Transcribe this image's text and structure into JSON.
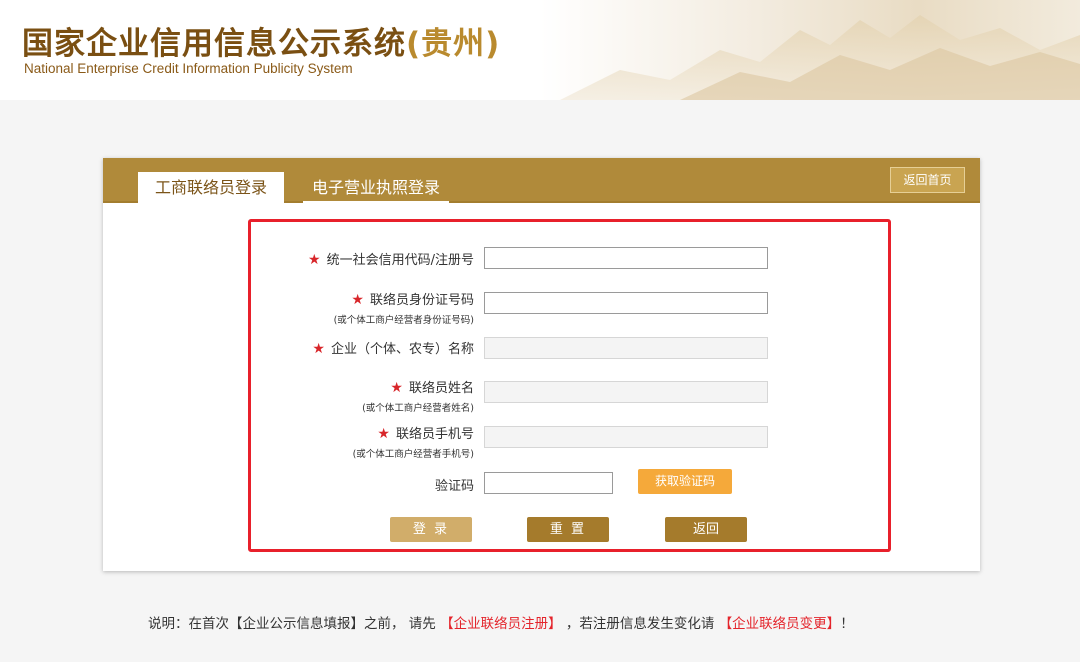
{
  "header": {
    "title": "国家企业信用信息公示系统",
    "title_region": "(贵州)",
    "subtitle": "National Enterprise Credit Information Publicity System"
  },
  "tabs": [
    {
      "label": "工商联络员登录",
      "active": true
    },
    {
      "label": "电子营业执照登录",
      "active": false
    }
  ],
  "home_button": "返回首页",
  "form": {
    "credit_code": {
      "label": "统一社会信用代码/注册号",
      "required": true,
      "value": ""
    },
    "id_number": {
      "label": "联络员身份证号码",
      "sub": "(或个体工商户经营者身份证号码)",
      "required": true,
      "value": ""
    },
    "company_name": {
      "label": "企业（个体、农专）名称",
      "required": true,
      "value": "",
      "disabled": true
    },
    "contact_name": {
      "label": "联络员姓名",
      "sub": "(或个体工商户经营者姓名)",
      "required": true,
      "value": "",
      "disabled": true
    },
    "contact_phone": {
      "label": "联络员手机号",
      "sub": "(或个体工商户经营者手机号)",
      "required": true,
      "value": "",
      "disabled": true
    },
    "captcha": {
      "label": "验证码",
      "value": ""
    },
    "get_code_button": "获取验证码",
    "required_mark": "★"
  },
  "buttons": {
    "login": "登 录",
    "reset": "重 置",
    "back": "返回"
  },
  "note": {
    "prefix": "说明：在首次【企业公示信息填报】之前， 请先",
    "link1": "【企业联络员注册】",
    "middle": "，若注册信息发生变化请",
    "link2": "【企业联络员变更】",
    "suffix": "！"
  },
  "colors": {
    "brand_brown": "#7a4f12",
    "tab_bar": "#b08a3a",
    "highlight_red": "#e8202b",
    "required_star": "#d8262a",
    "get_code_orange": "#f5a93a"
  }
}
